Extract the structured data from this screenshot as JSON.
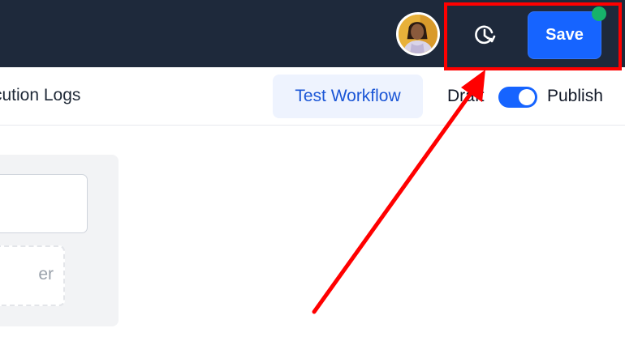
{
  "header": {
    "avatar_alt": "User avatar",
    "history_icon": "history-icon",
    "save_label": "Save",
    "status_color": "#17b26a"
  },
  "toolbar": {
    "execution_logs_label": "cution Logs",
    "test_workflow_label": "Test Workflow",
    "draft_label": "Draft",
    "publish_label": "Publish",
    "publish_toggle_on": true
  },
  "panel": {
    "drop_text": "er"
  },
  "colors": {
    "topbar": "#1e293b",
    "accent": "#1664ff",
    "annotation": "#ff0000"
  }
}
